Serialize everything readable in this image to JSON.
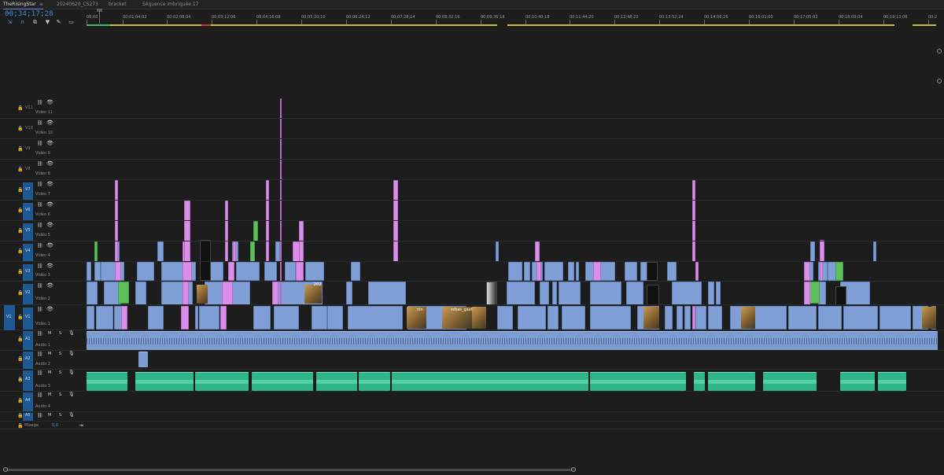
{
  "tabs": [
    {
      "label": "TheRisingStar",
      "active": true
    },
    {
      "label": "20240620_CS273",
      "active": false
    },
    {
      "label": "bracket",
      "active": false
    },
    {
      "label": "Séquence imbriquée 17",
      "active": false
    }
  ],
  "tab_menu_glyph": "≡",
  "timecode": "00;34;17;28",
  "tools": [
    "snap-icon",
    "linked-selection-icon",
    "add-marker-icon",
    "marker-icon",
    "wrench-icon",
    "captions-icon"
  ],
  "ruler_labels": [
    "00;00",
    "00;01;04;02",
    "00;02;08;04",
    "00;03;12;06",
    "00;04;16;08",
    "00;05;20;10",
    "00;06;24;12",
    "00;07;28;14",
    "00;08;32;16",
    "00;09;36;18",
    "00;10;40;18",
    "00;11;44;20",
    "00;12;48;22",
    "00;13;52;24",
    "00;14;56;26",
    "00;16;01;00",
    "00;17;05;02",
    "00;18;09;04",
    "00;19;13;06",
    "00;2"
  ],
  "video_tracks": [
    {
      "id": "V11",
      "name": "Vidéo 11"
    },
    {
      "id": "V10",
      "name": "Vidéo 10"
    },
    {
      "id": "V9",
      "name": "Vidéo 9"
    },
    {
      "id": "V8",
      "name": "Vidéo 8"
    },
    {
      "id": "V7",
      "name": "Vidéo 7"
    },
    {
      "id": "V6",
      "name": "Vidéo 6"
    },
    {
      "id": "V5",
      "name": "Vidéo 5"
    },
    {
      "id": "V4",
      "name": "Vidéo 4"
    },
    {
      "id": "V3",
      "name": "Vidéo 3"
    },
    {
      "id": "V2",
      "name": "Vidéo 2"
    },
    {
      "id": "V1",
      "name": "Vidéo 1",
      "source": "V1"
    }
  ],
  "audio_tracks": [
    {
      "id": "A1",
      "name": "Audio 1"
    },
    {
      "id": "A2",
      "name": "Audio 2"
    },
    {
      "id": "A3",
      "name": "Audio 3"
    },
    {
      "id": "A4",
      "name": "Audio 4"
    },
    {
      "id": "A5",
      "name": ""
    }
  ],
  "mute_label": "M",
  "solo_label": "S",
  "mix": {
    "label": "Mixage",
    "value": "0,0"
  },
  "clip_labels": {
    "v2_nest": "202",
    "v1_nest_a": "nin",
    "v1_nest_b": "rebas_gaat"
  },
  "colors": {
    "accent": "#3e8ede",
    "video_clip": "#7f9fd6",
    "pink_clip": "#d98ee8",
    "green_clip": "#5fbf5f",
    "music_clip": "#2eb48a",
    "work_area": "#c9b83a"
  }
}
